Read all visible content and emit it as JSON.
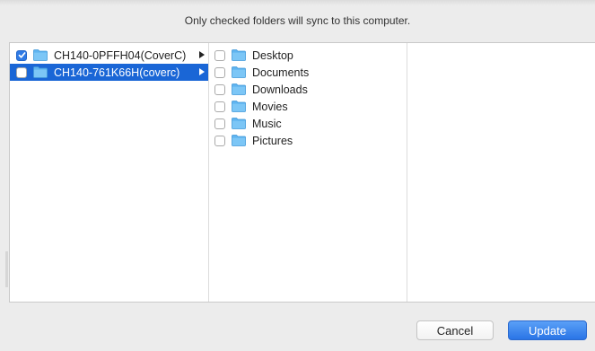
{
  "dialog": {
    "instruction": "Only checked folders will sync to this computer."
  },
  "accounts": [
    {
      "label": "CH140-0PFFH04(CoverC)",
      "checked": true,
      "selected": false
    },
    {
      "label": "CH140-761K66H(coverc)",
      "checked": false,
      "selected": true
    }
  ],
  "folders": [
    {
      "label": "Desktop",
      "checked": false
    },
    {
      "label": "Documents",
      "checked": false
    },
    {
      "label": "Downloads",
      "checked": false
    },
    {
      "label": "Movies",
      "checked": false
    },
    {
      "label": "Music",
      "checked": false
    },
    {
      "label": "Pictures",
      "checked": false
    }
  ],
  "buttons": {
    "cancel_label": "Cancel",
    "update_label": "Update"
  },
  "icons": {
    "folder": "folder-icon",
    "checkmark": "checkmark-icon",
    "disclosure": "disclosure-arrow-icon"
  },
  "colors": {
    "selection": "#1a66d6",
    "folder": "#5fb4f0",
    "primary_button": "#2a74e6"
  }
}
